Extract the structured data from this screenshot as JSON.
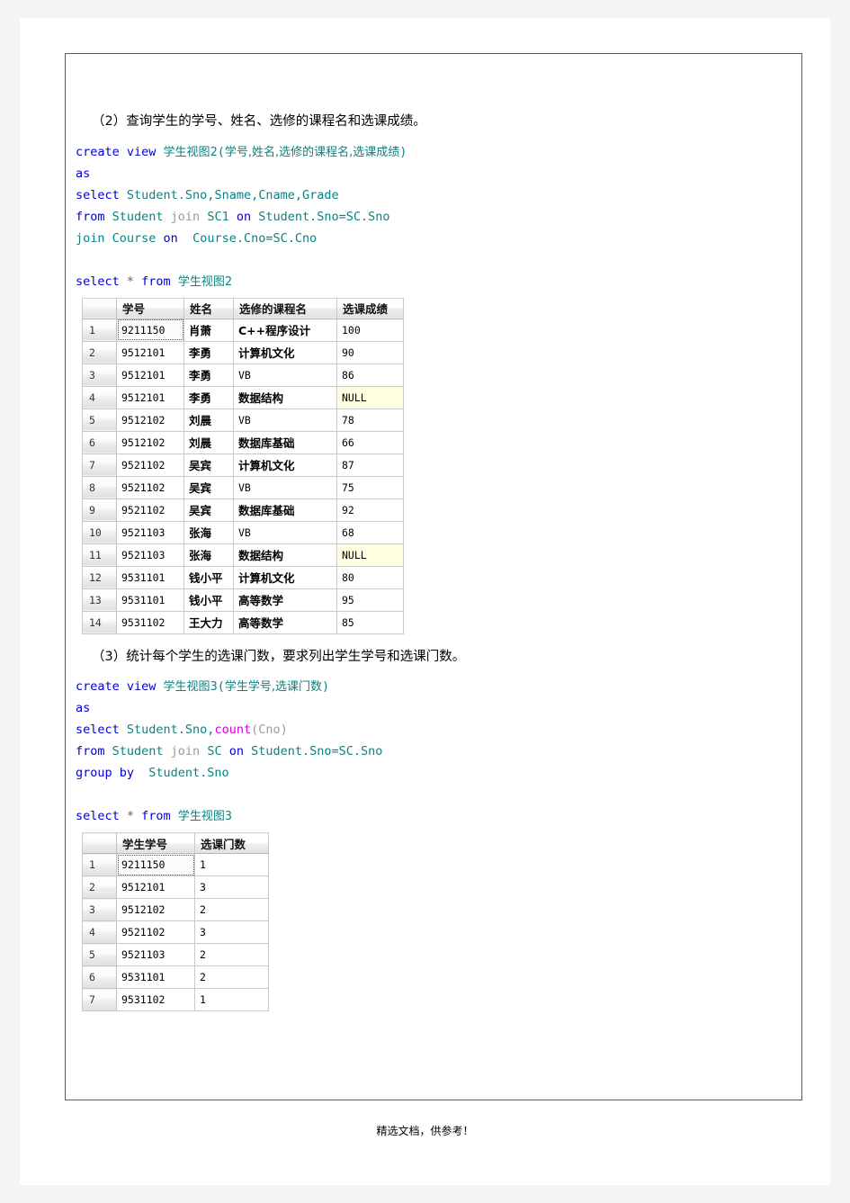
{
  "document": {
    "footer_note": "精选文档，供参考！"
  },
  "section2": {
    "heading": "（2）查询学生的学号、姓名、选修的课程名和选课成绩。",
    "code_lines": [
      [
        {
          "t": "create view ",
          "c": "kw"
        },
        {
          "t": "学生视图",
          "c": "ident cjk"
        },
        {
          "t": "2(",
          "c": "ident"
        },
        {
          "t": "学号,姓名,选修的课程名,选课成绩",
          "c": "ident cjk"
        },
        {
          "t": ")",
          "c": "ident"
        }
      ],
      [
        {
          "t": "as",
          "c": "kw"
        }
      ],
      [
        {
          "t": "select ",
          "c": "kw"
        },
        {
          "t": "Student.Sno,Sname,Cname,Grade",
          "c": "ident"
        }
      ],
      [
        {
          "t": "from ",
          "c": "kw"
        },
        {
          "t": "Student ",
          "c": "ident"
        },
        {
          "t": "join ",
          "c": "dim"
        },
        {
          "t": "SC1 ",
          "c": "ident"
        },
        {
          "t": "on ",
          "c": "kw"
        },
        {
          "t": "Student.Sno=SC.Sno",
          "c": "ident"
        }
      ],
      [
        {
          "t": "join ",
          "c": "ident"
        },
        {
          "t": "Course ",
          "c": "ident"
        },
        {
          "t": "on  ",
          "c": "kw"
        },
        {
          "t": "Course.Cno=SC.Cno",
          "c": "ident"
        }
      ]
    ],
    "query_lines": [
      [
        {
          "t": "select ",
          "c": "kw"
        },
        {
          "t": "* ",
          "c": "op"
        },
        {
          "t": "from ",
          "c": "kw"
        },
        {
          "t": "学生视图",
          "c": "ident cjk"
        },
        {
          "t": "2",
          "c": "ident"
        }
      ]
    ],
    "table": {
      "row_header": "",
      "columns": [
        "学号",
        "姓名",
        "选修的课程名",
        "选课成绩"
      ],
      "rows": [
        {
          "n": "1",
          "cells": [
            "9211150",
            "肖萧",
            "C++程序设计",
            "100"
          ],
          "selected": true,
          "null_index": -1
        },
        {
          "n": "2",
          "cells": [
            "9512101",
            "李勇",
            "计算机文化",
            "90"
          ],
          "selected": false,
          "null_index": -1
        },
        {
          "n": "3",
          "cells": [
            "9512101",
            "李勇",
            "VB",
            "86"
          ],
          "selected": false,
          "null_index": -1
        },
        {
          "n": "4",
          "cells": [
            "9512101",
            "李勇",
            "数据结构",
            "NULL"
          ],
          "selected": false,
          "null_index": 3
        },
        {
          "n": "5",
          "cells": [
            "9512102",
            "刘晨",
            "VB",
            "78"
          ],
          "selected": false,
          "null_index": -1
        },
        {
          "n": "6",
          "cells": [
            "9512102",
            "刘晨",
            "数据库基础",
            "66"
          ],
          "selected": false,
          "null_index": -1
        },
        {
          "n": "7",
          "cells": [
            "9521102",
            "吴宾",
            "计算机文化",
            "87"
          ],
          "selected": false,
          "null_index": -1
        },
        {
          "n": "8",
          "cells": [
            "9521102",
            "吴宾",
            "VB",
            "75"
          ],
          "selected": false,
          "null_index": -1
        },
        {
          "n": "9",
          "cells": [
            "9521102",
            "吴宾",
            "数据库基础",
            "92"
          ],
          "selected": false,
          "null_index": -1
        },
        {
          "n": "10",
          "cells": [
            "9521103",
            "张海",
            "VB",
            "68"
          ],
          "selected": false,
          "null_index": -1
        },
        {
          "n": "11",
          "cells": [
            "9521103",
            "张海",
            "数据结构",
            "NULL"
          ],
          "selected": false,
          "null_index": 3
        },
        {
          "n": "12",
          "cells": [
            "9531101",
            "钱小平",
            "计算机文化",
            "80"
          ],
          "selected": false,
          "null_index": -1
        },
        {
          "n": "13",
          "cells": [
            "9531101",
            "钱小平",
            "高等数学",
            "95"
          ],
          "selected": false,
          "null_index": -1
        },
        {
          "n": "14",
          "cells": [
            "9531102",
            "王大力",
            "高等数学",
            "85"
          ],
          "selected": false,
          "null_index": -1
        }
      ]
    }
  },
  "section3": {
    "heading": "（3）统计每个学生的选课门数，要求列出学生学号和选课门数。",
    "code_lines": [
      [
        {
          "t": "create view ",
          "c": "kw"
        },
        {
          "t": "学生视图",
          "c": "ident cjk"
        },
        {
          "t": "3(",
          "c": "ident"
        },
        {
          "t": "学生学号,选课门数",
          "c": "ident cjk"
        },
        {
          "t": ")",
          "c": "ident"
        }
      ],
      [
        {
          "t": "as",
          "c": "kw"
        }
      ],
      [
        {
          "t": "select ",
          "c": "kw"
        },
        {
          "t": "Student.Sno,",
          "c": "ident"
        },
        {
          "t": "count",
          "c": "fn"
        },
        {
          "t": "(Cno)",
          "c": "dim"
        }
      ],
      [
        {
          "t": "from ",
          "c": "kw"
        },
        {
          "t": "Student ",
          "c": "ident"
        },
        {
          "t": "join ",
          "c": "dim"
        },
        {
          "t": "SC ",
          "c": "ident"
        },
        {
          "t": "on ",
          "c": "kw"
        },
        {
          "t": "Student.Sno=SC.Sno",
          "c": "ident"
        }
      ],
      [
        {
          "t": "group by ",
          "c": "kw"
        },
        {
          "t": " Student.Sno",
          "c": "ident"
        }
      ]
    ],
    "query_lines": [
      [
        {
          "t": "select ",
          "c": "kw"
        },
        {
          "t": "* ",
          "c": "op"
        },
        {
          "t": "from ",
          "c": "kw"
        },
        {
          "t": "学生视图",
          "c": "ident cjk"
        },
        {
          "t": "3",
          "c": "ident"
        }
      ]
    ],
    "table": {
      "row_header": "",
      "columns": [
        "学生学号",
        "选课门数"
      ],
      "rows": [
        {
          "n": "1",
          "cells": [
            "9211150",
            "1"
          ],
          "selected": true,
          "null_index": -1
        },
        {
          "n": "2",
          "cells": [
            "9512101",
            "3"
          ],
          "selected": false,
          "null_index": -1
        },
        {
          "n": "3",
          "cells": [
            "9512102",
            "2"
          ],
          "selected": false,
          "null_index": -1
        },
        {
          "n": "4",
          "cells": [
            "9521102",
            "3"
          ],
          "selected": false,
          "null_index": -1
        },
        {
          "n": "5",
          "cells": [
            "9521103",
            "2"
          ],
          "selected": false,
          "null_index": -1
        },
        {
          "n": "6",
          "cells": [
            "9531101",
            "2"
          ],
          "selected": false,
          "null_index": -1
        },
        {
          "n": "7",
          "cells": [
            "9531102",
            "1"
          ],
          "selected": false,
          "null_index": -1
        }
      ]
    }
  },
  "colors": {
    "keyword": "#0000d0",
    "identifier": "#0f8080",
    "function": "#d400d4",
    "null_cell_bg": "#ffffe0",
    "grid_border": "#c9c9c9"
  }
}
